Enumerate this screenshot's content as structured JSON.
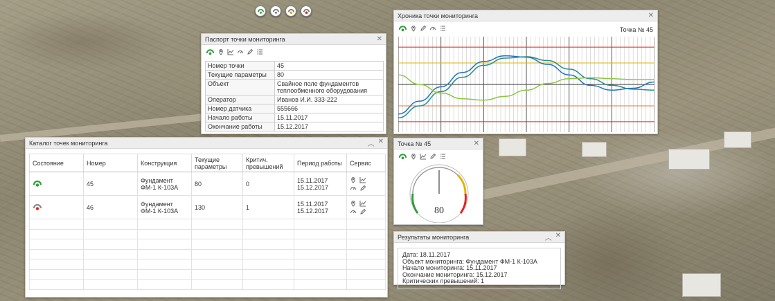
{
  "map_toolbar": [
    "sensor-green",
    "sensor-gray",
    "sensor-yellow",
    "sensor-red"
  ],
  "colors": {
    "green": "#2e9e3a",
    "yellow": "#e2b300",
    "red": "#e1251b",
    "blue": "#1e74c7",
    "teal": "#2a8c8a",
    "lime": "#8cc63f",
    "orange": "#e8772e"
  },
  "passport": {
    "title": "Паспорт точки мониторинга",
    "rows": [
      {
        "key": "Номер точки",
        "value": "45"
      },
      {
        "key": "Текущие параметры",
        "value": "80"
      },
      {
        "key": "Объект",
        "value": "Свайное поле фундаментов теплообменного оборудования"
      },
      {
        "key": "Оператор",
        "value": "Иванов И.И. 333-222"
      },
      {
        "key": "Номер датчика",
        "value": "555666"
      },
      {
        "key": "Начало работы",
        "value": "15.11.2017"
      },
      {
        "key": "Окончание работы",
        "value": "15.12.2017"
      }
    ]
  },
  "chronicle": {
    "title": "Хроника точки мониторинга",
    "point_label": "Точка № 45"
  },
  "chart_data": {
    "type": "line",
    "title": "",
    "xlabel": "",
    "ylabel": "",
    "ylim": [
      -1,
      1
    ],
    "x": [
      0,
      1,
      2,
      3,
      4,
      5,
      6,
      7,
      8,
      9,
      10,
      11,
      12
    ],
    "series": [
      {
        "values": [
          -0.62,
          -0.35,
          -0.05,
          0.25,
          0.48,
          0.6,
          0.57,
          0.42,
          0.2,
          -0.02,
          -0.12,
          -0.08,
          0.05
        ]
      },
      {
        "values": [
          -0.7,
          -0.45,
          -0.15,
          0.15,
          0.4,
          0.55,
          0.58,
          0.5,
          0.32,
          0.12,
          -0.02,
          -0.1,
          -0.12
        ]
      },
      {
        "values": [
          0.2,
          0.0,
          -0.18,
          -0.3,
          -0.33,
          -0.25,
          -0.12,
          0.02,
          0.12,
          0.14,
          0.12,
          0.1,
          0.1
        ]
      }
    ],
    "hlines": [
      {
        "y": 0.78,
        "color": "#e1251b"
      },
      {
        "y": 0.45,
        "color": "#e2b300"
      },
      {
        "y": 0.0,
        "color": "#333333"
      },
      {
        "y": -0.45,
        "color": "#e8772e"
      },
      {
        "y": -0.78,
        "color": "#e1251b"
      }
    ],
    "grid": true
  },
  "catalog": {
    "title": "Каталог точек мониторинга",
    "columns": [
      "Состояние",
      "Номер",
      "Конструкция",
      "Текущие параметры",
      "Критич. превышений",
      "Период работы",
      "Сервис"
    ],
    "rows": [
      {
        "state": "green",
        "number": "45",
        "construction": "Фундамент ФМ-1 К-103А",
        "params": "80",
        "critical": "0",
        "period": "15.11.2017 15.12.2017"
      },
      {
        "state": "red",
        "number": "46",
        "construction": "Фундамент ФМ-1 К-103А",
        "params": "130",
        "critical": "1",
        "period": "15.11.2017 15.12.2017"
      }
    ]
  },
  "gauge": {
    "title": "Точка № 45",
    "value": "80"
  },
  "results": {
    "title": "Результаты мониторинга",
    "lines": [
      "Дата: 18.11.2017",
      "Объект мониторинга: Фундамент ФМ-1 К-103А",
      "Начало мониторинга: 15.11.2017",
      "Окончание мониторинга: 15.12.2017",
      "Критических превышений: 1"
    ]
  }
}
